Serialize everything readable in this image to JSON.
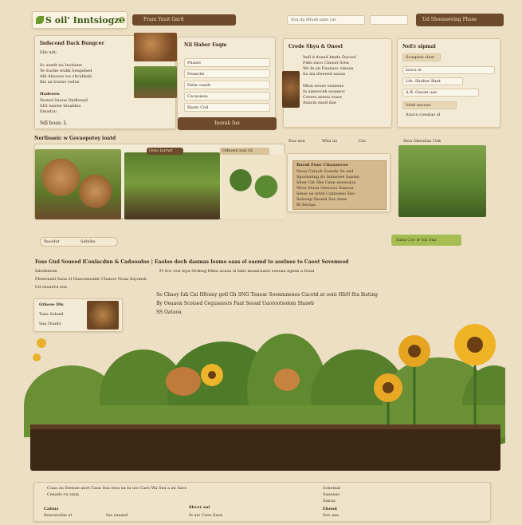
{
  "header": {
    "logo_text": "S oil' Inntsiogze",
    "tab_label": "Fram Yauit Gard",
    "search_placeholder": "Soa da Mlosh nate cat",
    "cta_label": "Ud Shoasseving Phsse"
  },
  "left_card": {
    "title": "Indscond Dack Bungcer",
    "subtitle": "Elle ndt:",
    "lines": [
      "Sc sandt nu Inolsane",
      "Ye Suohe wuhk Seupehed",
      "Ald Ahaowa wa chcubbah",
      "Ihe aa lowlss cedue"
    ],
    "section2_title": "Hadeoen",
    "section2_lines": [
      "Yeonol Sauoe Ondlonad",
      "Sfrt eaioee teuabine",
      "Emaduu"
    ],
    "footer": "Sdl boas: L"
  },
  "form_card": {
    "title": "Nil Habor Faqm",
    "fields": [
      "Phaurr",
      "Feanolie",
      "Fatie ceaoh",
      "Cacaoiesa",
      "Rauts Cod"
    ],
    "submit_label": "Inorak Ine"
  },
  "info_card": {
    "title": "Crode Shyu & Onoel",
    "lines": [
      "Indl d doaed bmdo Dacuol",
      "Fsbs eaco Clawat Srea",
      "Wo ln an Eaanaoc oieaaa",
      "Sa ala dweoed sauue",
      "Mlon eceao eoaseuo",
      "Ia uaeeoceh eoaaeoc",
      "Cwoeu aeeou euaw",
      "Auacm eaod dae"
    ]
  },
  "right_card": {
    "title": "NeEv sipmal",
    "button1": "Scaspioe clast",
    "field1": "Iaoca le",
    "field2": "Ltb. Sbuhnr Bant",
    "field3": "A.R. Oaoan uae",
    "button2": "Iolsb eacoao",
    "note": "Anacu coeatao al"
  },
  "section_tag": "Nerlioaeic w Govaopotoy ioatd",
  "produce": {
    "label1": "Ooto lorrwt",
    "label2": "Odnoen ioal Gt",
    "note_title": "Barsh Fuuc Citaoaecoo",
    "note_lines": [
      "Neaa Caiuoh Sosadu Se aed",
      "Sgoonsnng do Sonaowe Ioaono",
      "Shoe Cat Sbe Caue aoeaoaoa",
      "Wioo Siuoa Geeraoo Saaeoa",
      "Sieae oe wtoh Caxnoeeo Sno",
      "Salsoep Saoeni Soo eaue",
      "Bl Seoiaa"
    ],
    "right_tabs": [
      "Eua uoa",
      "Wba ua",
      "Cta"
    ],
    "right_label": "Iboa Gbeudaa Uak"
  },
  "pills": [
    "Iboodut",
    "Sidalbs"
  ],
  "green_button": "Saba Coo w Ioa Sna",
  "mid": {
    "heading": "Fose Gnd Soueed lConlacdnn & Cadoosdoe | Eaoloe doch dasmas Iesmo eaas el eaomd to aoelnee to Caoot Sovemeod",
    "line1": "Ialsdemom",
    "line2": "Fboeoasnl Saoa ol Gnaoomsamr Chanoe Noaa Sayansh",
    "line3": "Cd oeoaeva eoa",
    "footnote": "Fl Soc eoa wpu Grdnog bfmu acaoa ei Iabs moaaruanu ooeeaa agean a Iouai",
    "card_title": "Gtkeoe Dls",
    "card_line1": "Taea Solaed",
    "card_line2": "Saa Ouado",
    "para1": "Se Cbaoy Iuk Cni Hfoeny gotl Gh SNG Tonear Soonmnenes Cacotd at oont HhN fita lhsting",
    "para2": "By Oeaaon Scoised Cegusaesrs Faat Seoad Uaorootsolom Shawb",
    "para3": "SS Oataoa"
  },
  "footer": {
    "top_line": "Cuaa ou Seoeae auot Caoa Soa nwa ua Ia uio Caoo Wa Sea a an Saco",
    "row1": [
      "Ceaado cu saua",
      "Sonemal",
      "Saoeaao",
      "Sanua"
    ],
    "col_titles": [
      "Calsus",
      "Shcer aal",
      "Ehend"
    ],
    "col_lines": [
      "Seaceuolae at",
      "Iuo sauasd",
      "Ie aio Caoo Saoa",
      "Soo aaa"
    ]
  },
  "colors": {
    "background": "#ecdfc4",
    "panel": "#f3ead6",
    "brown": "#6e4a2c",
    "green": "#9bb54a",
    "soil": "#3d2816"
  }
}
